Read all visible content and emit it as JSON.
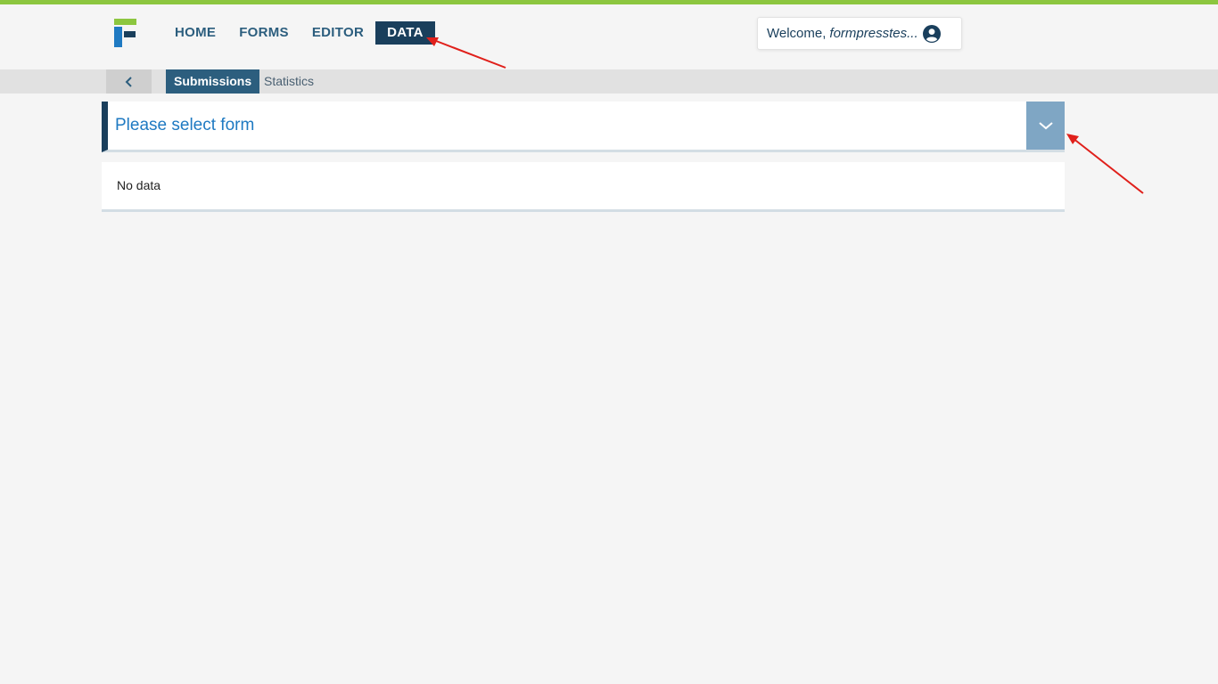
{
  "header": {
    "nav": [
      {
        "label": "HOME",
        "active": false
      },
      {
        "label": "FORMS",
        "active": false
      },
      {
        "label": "EDITOR",
        "active": false
      },
      {
        "label": "DATA",
        "active": true
      }
    ],
    "welcome_prefix": "Welcome,",
    "welcome_user": "formpresstes..."
  },
  "subnav": {
    "back_icon": "chevron-left-icon",
    "tabs": [
      {
        "label": "Submissions",
        "active": true
      },
      {
        "label": "Statistics",
        "active": false
      }
    ]
  },
  "form_select": {
    "placeholder": "Please select form",
    "toggle_icon": "chevron-down-icon"
  },
  "data_panel": {
    "message": "No data"
  },
  "colors": {
    "accent_green": "#8cc63f",
    "navy": "#1a3f5c",
    "blue": "#1f7ac2",
    "annotation_red": "#e0201b"
  }
}
